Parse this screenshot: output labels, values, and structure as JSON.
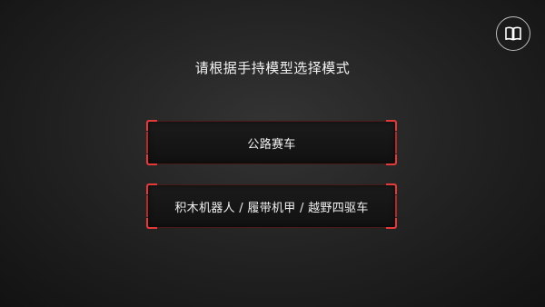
{
  "header": {
    "manual_icon": "book-open-icon"
  },
  "prompt": {
    "text": "请根据手持模型选择模式"
  },
  "modes": [
    {
      "label": "公路赛车"
    },
    {
      "label": "积木机器人 / 履带机甲 / 越野四驱车"
    }
  ],
  "colors": {
    "background": "#242424",
    "accent": "#e23a3a",
    "text": "#f0f0f0",
    "icon_ring": "#bdbdbd"
  }
}
